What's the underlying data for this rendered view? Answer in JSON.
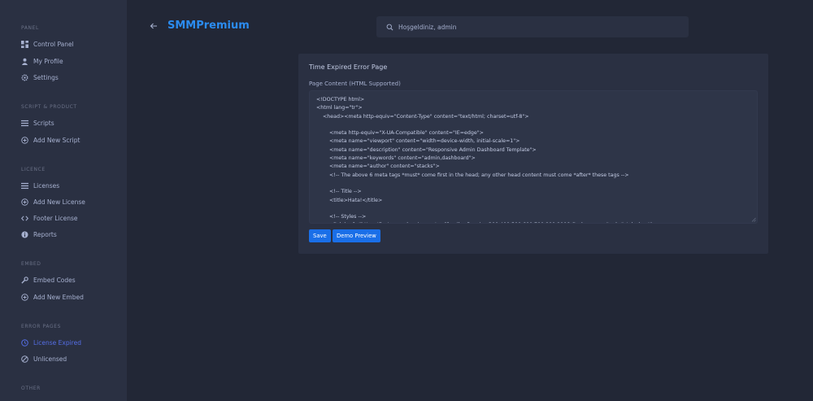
{
  "sidebar": {
    "sections": [
      {
        "title": "PANEL"
      },
      {
        "title": "SCRIPT & PRODUCT"
      },
      {
        "title": "LICENCE"
      },
      {
        "title": "EMBED"
      },
      {
        "title": "ERROR PAGES"
      },
      {
        "title": "OTHER"
      }
    ],
    "items": [
      {
        "label": "Control Panel",
        "icon": "dashboard-icon"
      },
      {
        "label": "My Profile",
        "icon": "user-icon"
      },
      {
        "label": "Settings",
        "icon": "gear-icon"
      },
      {
        "label": "Scripts",
        "icon": "list-icon"
      },
      {
        "label": "Add New Script",
        "icon": "plus-circle-icon"
      },
      {
        "label": "Licenses",
        "icon": "list-icon"
      },
      {
        "label": "Add New License",
        "icon": "plus-circle-icon"
      },
      {
        "label": "Footer License",
        "icon": "code-icon"
      },
      {
        "label": "Reports",
        "icon": "info-icon"
      },
      {
        "label": "Embed Codes",
        "icon": "wrench-icon"
      },
      {
        "label": "Add New Embed",
        "icon": "plus-circle-icon"
      },
      {
        "label": "License Expired",
        "icon": "clock-icon",
        "active": true
      },
      {
        "label": "Unlicensed",
        "icon": "ban-icon"
      }
    ]
  },
  "header": {
    "brand": "SMMPremium",
    "search_text": "Hoşgeldiniz, admin"
  },
  "card": {
    "title": "Time Expired Error Page",
    "field_label": "Page Content (HTML Supported)",
    "content": "<!DOCTYPE html>\n<html lang=\"tr\">\n    <head><meta http-equiv=\"Content-Type\" content=\"text/html; charset=utf-8\">\n\n        <meta http-equiv=\"X-UA-Compatible\" content=\"IE=edge\">\n        <meta name=\"viewport\" content=\"width=device-width, initial-scale=1\">\n        <meta name=\"description\" content=\"Responsive Admin Dashboard Template\">\n        <meta name=\"keywords\" content=\"admin,dashboard\">\n        <meta name=\"author\" content=\"stacks\">\n        <!-- The above 6 meta tags *must* come first in the head; any other head content must come *after* these tags -->\n\n        <!-- Title -->\n        <title>Hata!</title>\n\n        <!-- Styles -->\n        <link href=\"https://fonts.googleapis.com/css?family=Poppins:300,400,500,600,700,800,900&display=swap\" rel=\"stylesheet\">",
    "save_label": "Save",
    "preview_label": "Demo Preview"
  },
  "colors": {
    "accent": "#556ee6",
    "brand": "#2b8cf0",
    "button": "#1a6fe8"
  }
}
